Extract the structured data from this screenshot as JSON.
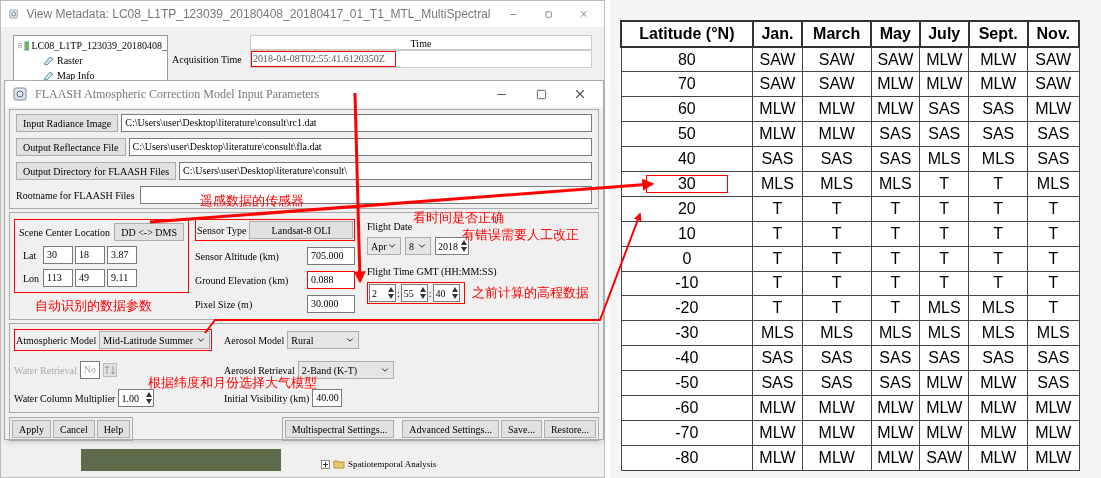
{
  "metadata_window": {
    "title": "View Metadata: LC08_L1TP_123039_20180408_20180417_01_T1_MTL_MultiSpectral",
    "tree": [
      {
        "label": "LC08_L1TP_123039_20180408_",
        "expanded": true,
        "children": [
          {
            "label": "Raster"
          },
          {
            "label": "Map Info"
          }
        ]
      }
    ],
    "column_header": "Time",
    "field_label": "Acquisition Time",
    "field_value": "2018-04-08T02:55:41.6120350Z"
  },
  "flaash_window": {
    "title": "FLAASH Atmospheric Correction Model Input Parameters",
    "files": [
      {
        "kind": "button",
        "label": "Input Radiance Image",
        "value": "C:\\Users\\user\\Desktop\\literature\\consult\\rc1.dat"
      },
      {
        "kind": "button",
        "label": "Output Reflectance File",
        "value": "C:\\Users\\user\\Desktop\\literature\\consult\\fla.dat"
      },
      {
        "kind": "button",
        "label": "Output Directory for FLAASH Files",
        "value": "C:\\Users\\user\\Desktop\\literature\\consult\\"
      },
      {
        "kind": "label",
        "label": "Rootname for FLAASH Files"
      }
    ],
    "scene": {
      "title": "Scene Center Location",
      "toggle": "DD <-> DMS",
      "coords": [
        {
          "label": "Lat",
          "values": [
            "30",
            "18",
            "3.87"
          ]
        },
        {
          "label": "Lon",
          "values": [
            "113",
            "49",
            "9.11"
          ]
        }
      ]
    },
    "sensor": [
      {
        "kind": "button",
        "label": "Sensor Type",
        "value": "Landsat-8 OLI"
      },
      {
        "kind": "field",
        "label": "Sensor Altitude (km)",
        "value": "705.000"
      },
      {
        "kind": "field",
        "label": "Ground Elevation (km)",
        "value": "0.088"
      },
      {
        "kind": "field",
        "label": "Pixel Size (m)",
        "value": "30.000"
      }
    ],
    "flight_date": {
      "label": "Flight Date",
      "month": "Apr",
      "day": "8",
      "year": "2018"
    },
    "flight_time": {
      "label": "Flight Time GMT (HH:MM:SS)",
      "separator": ":",
      "values": [
        "2",
        "55",
        "40"
      ]
    },
    "atmosphere": {
      "model_label": "Atmospheric Model",
      "model": "Mid-Latitude Summer",
      "aerosol_label": "Aerosol Model",
      "aerosol": "Rural",
      "water_label": "Water Retrieval",
      "water": "No",
      "water_disabled": true,
      "retrieval_label": "Aerosol Retrieval",
      "retrieval": "2-Band (K-T)",
      "multiplier_label": "Water Column Multiplier",
      "multiplier": "1.00",
      "visibility_label": "Initial Visibility (km)",
      "visibility": "40.00"
    },
    "buttons_left": [
      "Apply",
      "Cancel",
      "Help"
    ],
    "buttons_right": [
      "Multispectral Settings...",
      "Advanced Settings...",
      "Save...",
      "Restore..."
    ]
  },
  "background_tree": {
    "label": "Spatiotemporal Analysis"
  },
  "annotations": [
    {
      "kind": "sensor",
      "text": "遥感数据的传感器"
    },
    {
      "kind": "time_check",
      "text": "看时间是否正确"
    },
    {
      "kind": "time_fix",
      "text": "有错误需要人工改正"
    },
    {
      "kind": "auto",
      "text": "自动识别的数据参数"
    },
    {
      "kind": "elevation",
      "text": "之前计算的高程数据"
    },
    {
      "kind": "model",
      "text": "根据纬度和月份选择大气模型"
    }
  ],
  "table": {
    "columns": [
      "Latitude (°N)",
      "Jan.",
      "March",
      "May",
      "July",
      "Sept.",
      "Nov."
    ],
    "rows": [
      {
        "highlighted": false,
        "cells": [
          "80",
          "SAW",
          "SAW",
          "SAW",
          "MLW",
          "MLW",
          "SAW"
        ]
      },
      {
        "highlighted": false,
        "cells": [
          "70",
          "SAW",
          "SAW",
          "MLW",
          "MLW",
          "MLW",
          "SAW"
        ]
      },
      {
        "highlighted": false,
        "cells": [
          "60",
          "MLW",
          "MLW",
          "MLW",
          "SAS",
          "SAS",
          "MLW"
        ]
      },
      {
        "highlighted": false,
        "cells": [
          "50",
          "MLW",
          "MLW",
          "SAS",
          "SAS",
          "SAS",
          "SAS"
        ]
      },
      {
        "highlighted": false,
        "cells": [
          "40",
          "SAS",
          "SAS",
          "SAS",
          "MLS",
          "MLS",
          "SAS"
        ]
      },
      {
        "highlighted": true,
        "cells": [
          "30",
          "MLS",
          "MLS",
          "MLS",
          "T",
          "T",
          "MLS"
        ]
      },
      {
        "highlighted": false,
        "cells": [
          "20",
          "T",
          "T",
          "T",
          "T",
          "T",
          "T"
        ]
      },
      {
        "highlighted": false,
        "cells": [
          "10",
          "T",
          "T",
          "T",
          "T",
          "T",
          "T"
        ]
      },
      {
        "highlighted": false,
        "cells": [
          "0",
          "T",
          "T",
          "T",
          "T",
          "T",
          "T"
        ]
      },
      {
        "highlighted": false,
        "cells": [
          "-10",
          "T",
          "T",
          "T",
          "T",
          "T",
          "T"
        ]
      },
      {
        "highlighted": false,
        "cells": [
          "-20",
          "T",
          "T",
          "T",
          "MLS",
          "MLS",
          "T"
        ]
      },
      {
        "highlighted": false,
        "cells": [
          "-30",
          "MLS",
          "MLS",
          "MLS",
          "MLS",
          "MLS",
          "MLS"
        ]
      },
      {
        "highlighted": false,
        "cells": [
          "-40",
          "SAS",
          "SAS",
          "SAS",
          "SAS",
          "SAS",
          "SAS"
        ]
      },
      {
        "highlighted": false,
        "cells": [
          "-50",
          "SAS",
          "SAS",
          "SAS",
          "MLW",
          "MLW",
          "SAS"
        ]
      },
      {
        "highlighted": false,
        "cells": [
          "-60",
          "MLW",
          "MLW",
          "MLW",
          "MLW",
          "MLW",
          "MLW"
        ]
      },
      {
        "highlighted": false,
        "cells": [
          "-70",
          "MLW",
          "MLW",
          "MLW",
          "MLW",
          "MLW",
          "MLW"
        ]
      },
      {
        "highlighted": false,
        "cells": [
          "-80",
          "MLW",
          "MLW",
          "MLW",
          "SAW",
          "MLW",
          "MLW"
        ]
      }
    ]
  }
}
